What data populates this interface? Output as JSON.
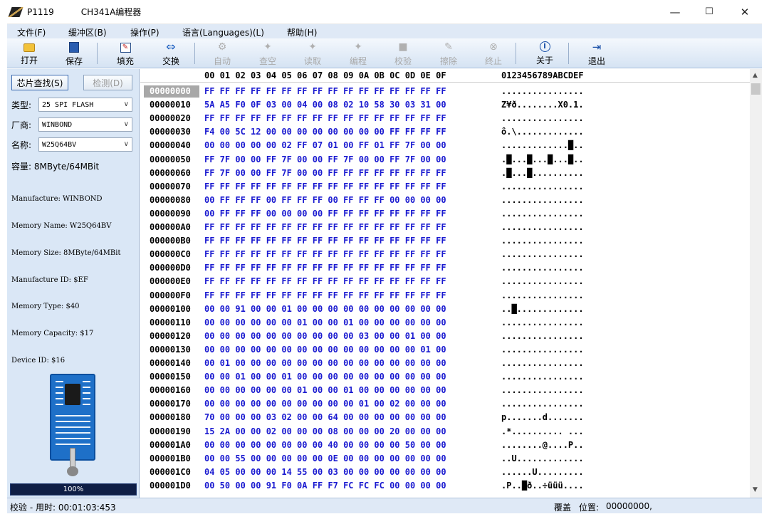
{
  "window": {
    "icon": "chip-icon",
    "title": "P1119",
    "app_name": "CH341A编程器",
    "minimize": "—",
    "maximize": "☐",
    "close": "✕"
  },
  "menu": [
    "文件(F)",
    "缓冲区(B)",
    "操作(P)",
    "语言(Languages)(L)",
    "帮助(H)"
  ],
  "toolbar": [
    {
      "label": "打开",
      "icon": "open-folder-icon",
      "enabled": true
    },
    {
      "label": "保存",
      "icon": "save-icon",
      "enabled": true
    },
    {
      "label": "填充",
      "icon": "fill-icon",
      "enabled": true
    },
    {
      "label": "交换",
      "icon": "swap-icon",
      "enabled": true
    },
    {
      "label": "自动",
      "icon": "auto-icon",
      "enabled": false
    },
    {
      "label": "查空",
      "icon": "blank-check-icon",
      "enabled": false
    },
    {
      "label": "读取",
      "icon": "read-icon",
      "enabled": false
    },
    {
      "label": "编程",
      "icon": "program-icon",
      "enabled": false
    },
    {
      "label": "校验",
      "icon": "verify-icon",
      "enabled": false
    },
    {
      "label": "擦除",
      "icon": "erase-icon",
      "enabled": false
    },
    {
      "label": "终止",
      "icon": "stop-icon",
      "enabled": false
    },
    {
      "label": "关于",
      "icon": "info-icon",
      "enabled": true
    },
    {
      "label": "退出",
      "icon": "exit-icon",
      "enabled": true
    }
  ],
  "left": {
    "find_chip": "芯片查找(S)",
    "detect": "检测(D)",
    "type_label": "类型:",
    "type_value": "25 SPI FLASH",
    "vendor_label": "厂商:",
    "vendor_value": "WINBOND",
    "name_label": "名称:",
    "name_value": "W25Q64BV",
    "capacity": "容量: 8MByte/64MBit",
    "info_lines": [
      "Manufacture: WINBOND",
      "Memory Name: W25Q64BV",
      "Memory Size: 8MByte/64MBit",
      "Manufacture ID: $EF",
      "Memory Type: $40",
      "Memory Capacity: $17",
      "Device ID: $16"
    ],
    "progress_label": "100%",
    "progress_value": 100
  },
  "hex": {
    "header_cols": "00 01 02 03 04 05 06 07 08 09 0A 0B 0C 0D 0E 0F",
    "header_ascii": "0123456789ABCDEF",
    "rows": [
      {
        "addr": "00000000",
        "bytes": "FF FF FF FF FF FF FF FF FF FF FF FF FF FF FF FF",
        "ascii": "................"
      },
      {
        "addr": "00000010",
        "bytes": "5A A5 F0 0F 03 00 04 00 08 02 10 58 30 03 31 00",
        "ascii": "Z¥ð........X0.1."
      },
      {
        "addr": "00000020",
        "bytes": "FF FF FF FF FF FF FF FF FF FF FF FF FF FF FF FF",
        "ascii": "................"
      },
      {
        "addr": "00000030",
        "bytes": "F4 00 5C 12 00 00 00 00 00 00 00 00 FF FF FF FF",
        "ascii": "ô.\\............."
      },
      {
        "addr": "00000040",
        "bytes": "00 00 00 00 00 02 FF 07 01 00 FF 01 FF 7F 00 00",
        "ascii": ".............█.."
      },
      {
        "addr": "00000050",
        "bytes": "FF 7F 00 00 FF 7F 00 00 FF 7F 00 00 FF 7F 00 00",
        "ascii": ".█...█...█...█.."
      },
      {
        "addr": "00000060",
        "bytes": "FF 7F 00 00 FF 7F 00 00 FF FF FF FF FF FF FF FF",
        "ascii": ".█...█.........."
      },
      {
        "addr": "00000070",
        "bytes": "FF FF FF FF FF FF FF FF FF FF FF FF FF FF FF FF",
        "ascii": "................"
      },
      {
        "addr": "00000080",
        "bytes": "00 FF FF FF 00 FF FF FF 00 FF FF FF 00 00 00 00",
        "ascii": "................"
      },
      {
        "addr": "00000090",
        "bytes": "00 FF FF FF 00 00 00 00 FF FF FF FF FF FF FF FF",
        "ascii": "................"
      },
      {
        "addr": "000000A0",
        "bytes": "FF FF FF FF FF FF FF FF FF FF FF FF FF FF FF FF",
        "ascii": "................"
      },
      {
        "addr": "000000B0",
        "bytes": "FF FF FF FF FF FF FF FF FF FF FF FF FF FF FF FF",
        "ascii": "................"
      },
      {
        "addr": "000000C0",
        "bytes": "FF FF FF FF FF FF FF FF FF FF FF FF FF FF FF FF",
        "ascii": "................"
      },
      {
        "addr": "000000D0",
        "bytes": "FF FF FF FF FF FF FF FF FF FF FF FF FF FF FF FF",
        "ascii": "................"
      },
      {
        "addr": "000000E0",
        "bytes": "FF FF FF FF FF FF FF FF FF FF FF FF FF FF FF FF",
        "ascii": "................"
      },
      {
        "addr": "000000F0",
        "bytes": "FF FF FF FF FF FF FF FF FF FF FF FF FF FF FF FF",
        "ascii": "................"
      },
      {
        "addr": "00000100",
        "bytes": "00 00 91 00 00 01 00 00 00 00 00 00 00 00 00 00",
        "ascii": "..█............."
      },
      {
        "addr": "00000110",
        "bytes": "00 00 00 00 00 00 01 00 00 01 00 00 00 00 00 00",
        "ascii": "................"
      },
      {
        "addr": "00000120",
        "bytes": "00 00 00 00 00 00 00 00 00 00 03 00 00 01 00 00",
        "ascii": "................"
      },
      {
        "addr": "00000130",
        "bytes": "00 00 00 00 00 00 00 00 00 00 00 00 00 00 01 00",
        "ascii": "................"
      },
      {
        "addr": "00000140",
        "bytes": "00 01 00 00 00 00 00 00 00 00 00 00 00 00 00 00",
        "ascii": "................"
      },
      {
        "addr": "00000150",
        "bytes": "00 00 01 00 00 01 00 00 00 00 00 00 00 00 00 00",
        "ascii": "................"
      },
      {
        "addr": "00000160",
        "bytes": "00 00 00 00 00 00 01 00 00 01 00 00 00 00 00 00",
        "ascii": "................"
      },
      {
        "addr": "00000170",
        "bytes": "00 00 00 00 00 00 00 00 00 00 01 00 02 00 00 00",
        "ascii": "................"
      },
      {
        "addr": "00000180",
        "bytes": "70 00 00 00 03 02 00 00 64 00 00 00 00 00 00 00",
        "ascii": "p.......d......."
      },
      {
        "addr": "00000190",
        "bytes": "15 2A 00 00 02 00 00 00 08 00 00 00 20 00 00 00",
        "ascii": ".*.......... ..."
      },
      {
        "addr": "000001A0",
        "bytes": "00 00 00 00 00 00 00 00 40 00 00 00 00 50 00 00",
        "ascii": "........@....P.."
      },
      {
        "addr": "000001B0",
        "bytes": "00 00 55 00 00 00 00 00 0E 00 00 00 00 00 00 00",
        "ascii": "..U............."
      },
      {
        "addr": "000001C0",
        "bytes": "04 05 00 00 00 14 55 00 03 00 00 00 00 00 00 00",
        "ascii": "......U........."
      },
      {
        "addr": "000001D0",
        "bytes": "00 50 00 00 91 F0 0A FF F7 FC FC FC 00 00 00 00",
        "ascii": ".P..█ð..÷üüü...."
      }
    ]
  },
  "status": {
    "left": "校验 - 用时: 00:01:03:453",
    "mode": "覆盖",
    "pos_label": "位置:",
    "pos_value": "00000000,"
  }
}
